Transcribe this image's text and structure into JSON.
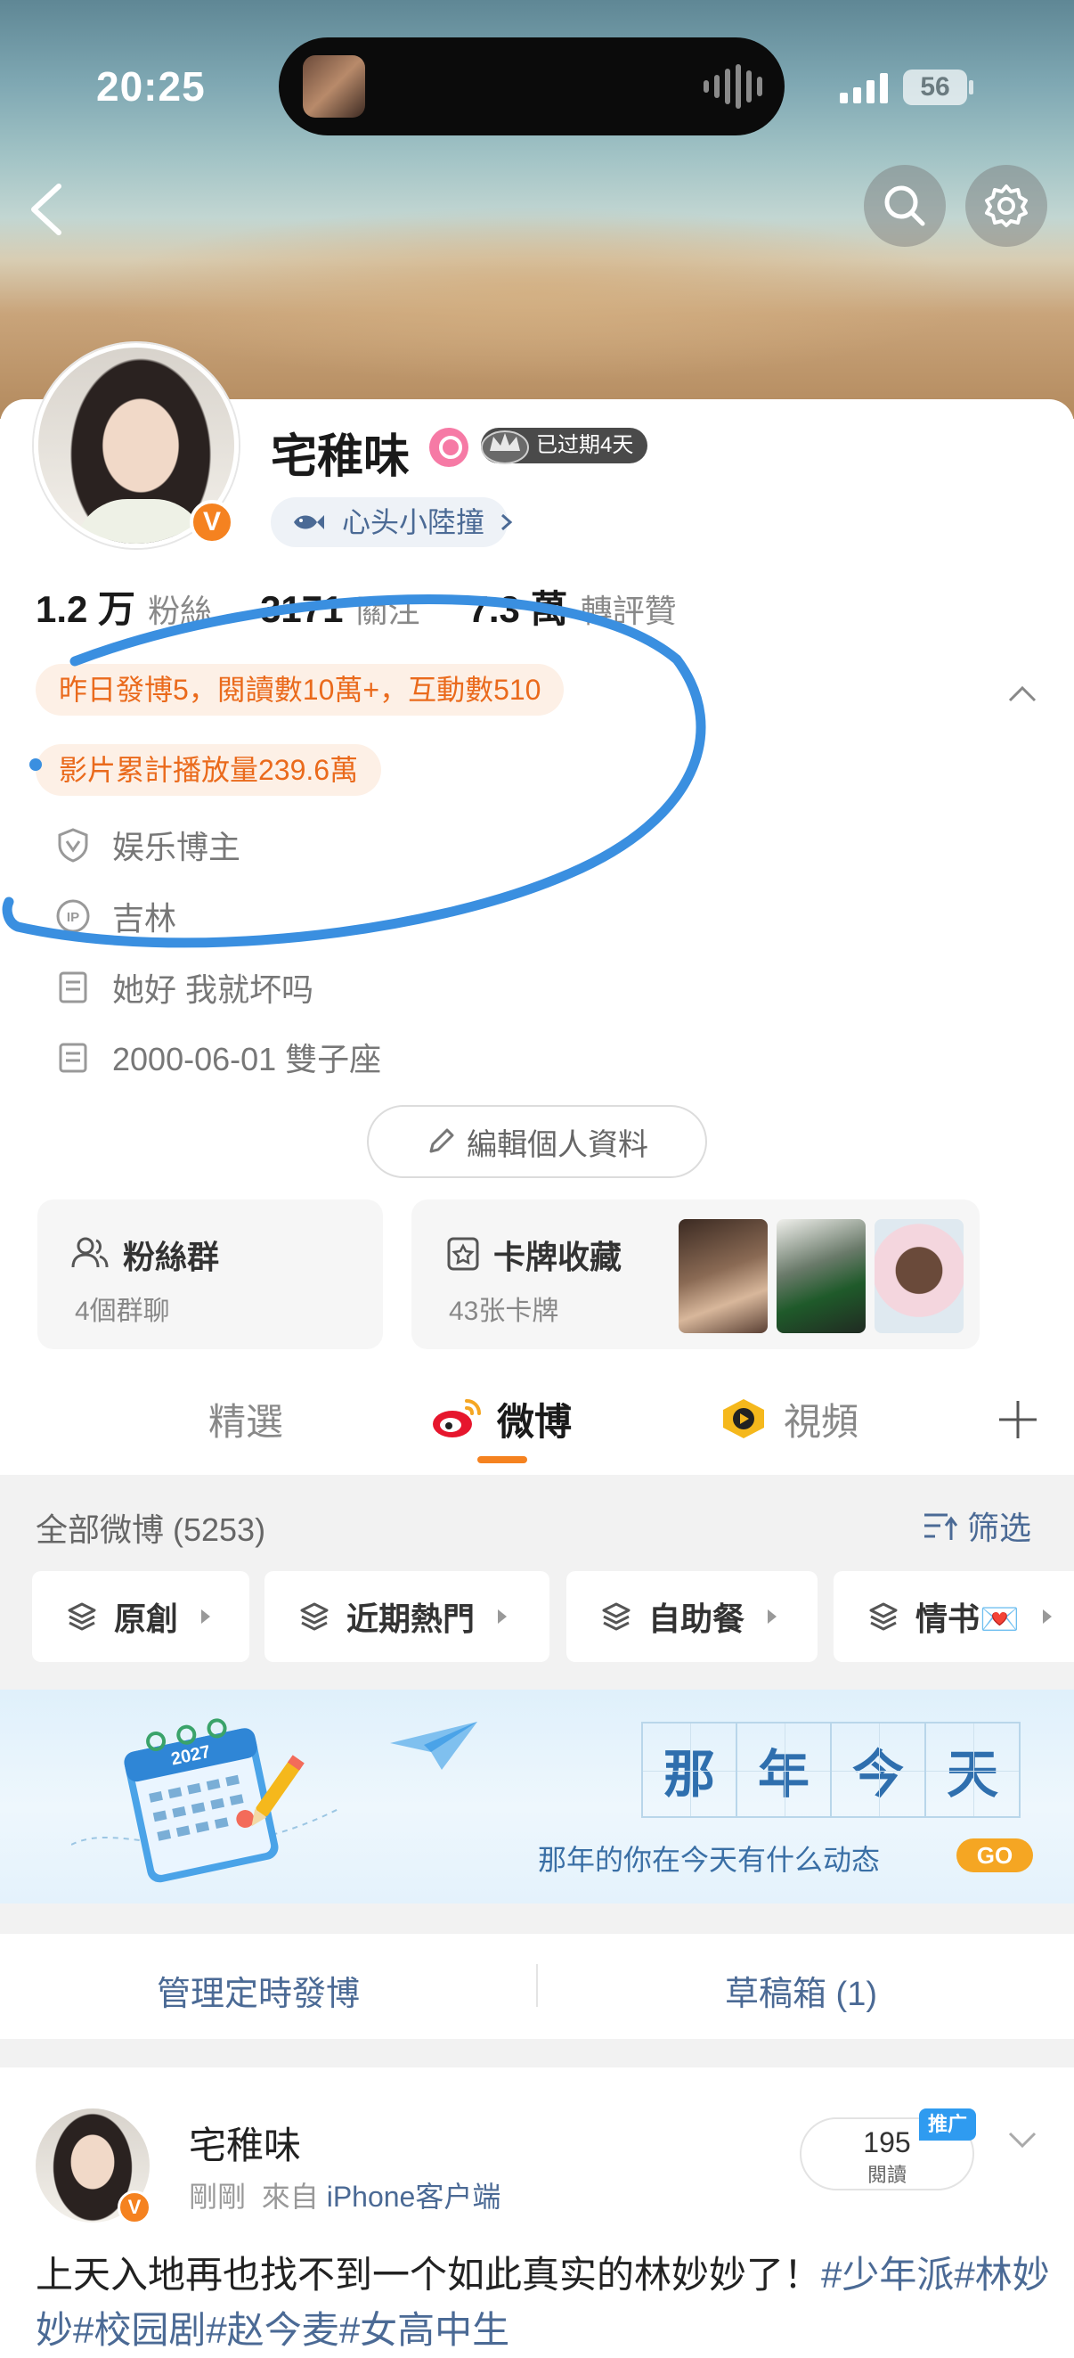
{
  "status_bar": {
    "time": "20:25",
    "battery": "56"
  },
  "profile": {
    "nickname": "宅稚味",
    "vip_badge": "已过期4天",
    "fan_badge": "心头小陸撞",
    "stats": [
      {
        "value": "1.2 万",
        "label": "粉絲"
      },
      {
        "value": "3171",
        "label": "關注"
      },
      {
        "value": "7.3 萬",
        "label": "轉評贊"
      }
    ],
    "highlight_yesterday": "昨日發博5，閱讀數10萬+，互動數510",
    "highlight_video": "影片累計播放量239.6萬",
    "info": {
      "category": "娱乐博主",
      "ip_location": "吉林",
      "bio": "她好 我就坏吗",
      "birthday": "2000-06-01 雙子座"
    },
    "edit_button": "編輯個人資料"
  },
  "tiles": {
    "fan_group": {
      "title": "粉絲群",
      "sub": "4個群聊"
    },
    "card_collection": {
      "title": "卡牌收藏",
      "sub": "43张卡牌"
    }
  },
  "tabs": [
    {
      "label": "精選"
    },
    {
      "label": "微博"
    },
    {
      "label": "視頻"
    }
  ],
  "feed": {
    "all_count": "全部微博 (5253)",
    "filter": "筛选",
    "chips": [
      "原創",
      "近期熱門",
      "自助餐",
      "情书💌"
    ]
  },
  "banner": {
    "title_chars": [
      "那",
      "年",
      "今",
      "天"
    ],
    "calendar_year": "2027",
    "subtitle": "那年的你在今天有什么动态",
    "go": "GO"
  },
  "actions": {
    "scheduled": "管理定時發博",
    "drafts": "草稿箱 (1)"
  },
  "post": {
    "author": "宅稚味",
    "time": "剛剛",
    "source_prefix": "來自",
    "source": "iPhone客户端",
    "reads_value": "195",
    "reads_label": "閱讀",
    "promo": "推广",
    "text_main": "上天入地再也找不到一个如此真实的林妙妙了！",
    "text_tags": "#少年派#林妙妙#校园剧#赵今麦#女高中生"
  },
  "colors": {
    "accent_orange": "#f58220",
    "link_blue": "#4b6a95",
    "annotation_blue": "#3a8fe0"
  }
}
